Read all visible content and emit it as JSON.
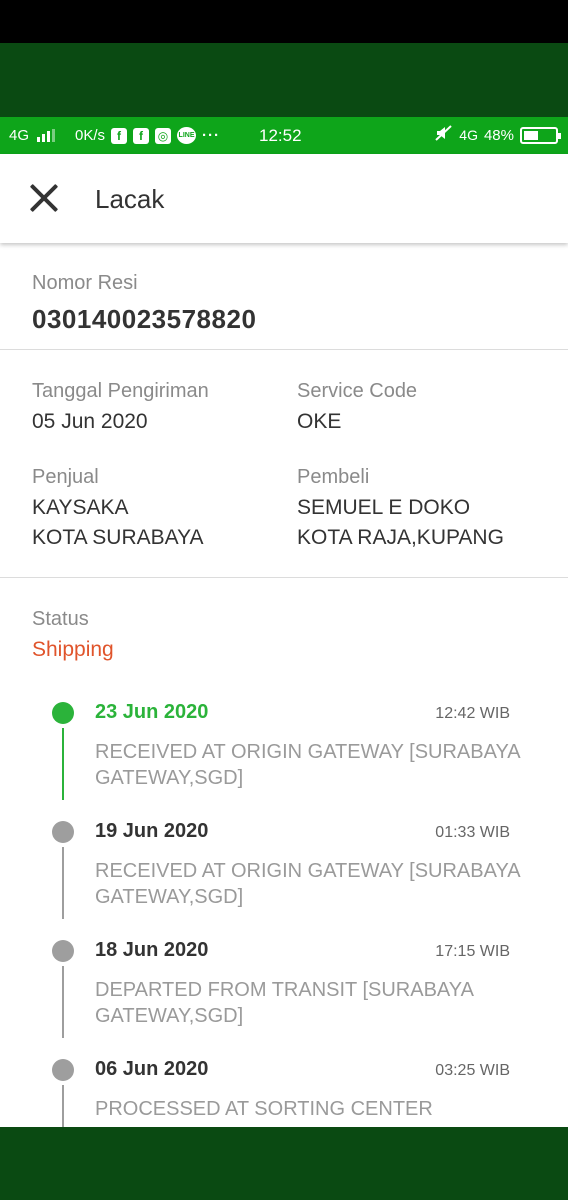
{
  "status_bar": {
    "network": "4G",
    "speed": "0K/s",
    "apps": [
      {
        "icon": "facebook-icon",
        "glyph": "f"
      },
      {
        "icon": "facebook-icon",
        "glyph": "f"
      },
      {
        "icon": "instagram-icon",
        "glyph": "◎"
      },
      {
        "icon": "line-icon",
        "glyph": "LINE"
      }
    ],
    "more": "···",
    "time": "12:52",
    "network_right": "4G",
    "battery": "48%",
    "battery_level": 0.48
  },
  "header": {
    "title": "Lacak"
  },
  "shipment": {
    "resi_label": "Nomor Resi",
    "resi_number": "030140023578820",
    "date_label": "Tanggal Pengiriman",
    "date_value": "05 Jun 2020",
    "service_label": "Service Code",
    "service_value": "OKE",
    "seller_label": "Penjual",
    "seller_name": "KAYSAKA",
    "seller_city": "KOTA SURABAYA",
    "buyer_label": "Pembeli",
    "buyer_name": "SEMUEL E DOKO",
    "buyer_city": "KOTA RAJA,KUPANG"
  },
  "status": {
    "label": "Status",
    "value": "Shipping",
    "color": "#e0542b"
  },
  "timeline": [
    {
      "date": "23 Jun 2020",
      "time": "12:42 WIB",
      "desc": "RECEIVED AT ORIGIN GATEWAY [SURABAYA GATEWAY,SGD]",
      "active": true
    },
    {
      "date": "19 Jun 2020",
      "time": "01:33 WIB",
      "desc": "RECEIVED AT ORIGIN GATEWAY [SURABAYA GATEWAY,SGD]",
      "active": false
    },
    {
      "date": "18 Jun 2020",
      "time": "17:15 WIB",
      "desc": "DEPARTED FROM TRANSIT [SURABAYA GATEWAY,SGD]",
      "active": false
    },
    {
      "date": "06 Jun 2020",
      "time": "03:25 WIB",
      "desc": "PROCESSED AT SORTING CENTER",
      "active": false
    }
  ],
  "colors": {
    "accent_green": "#2bb33a",
    "statusbar_green": "#0ea51a",
    "dark_green": "#0a4a12"
  }
}
